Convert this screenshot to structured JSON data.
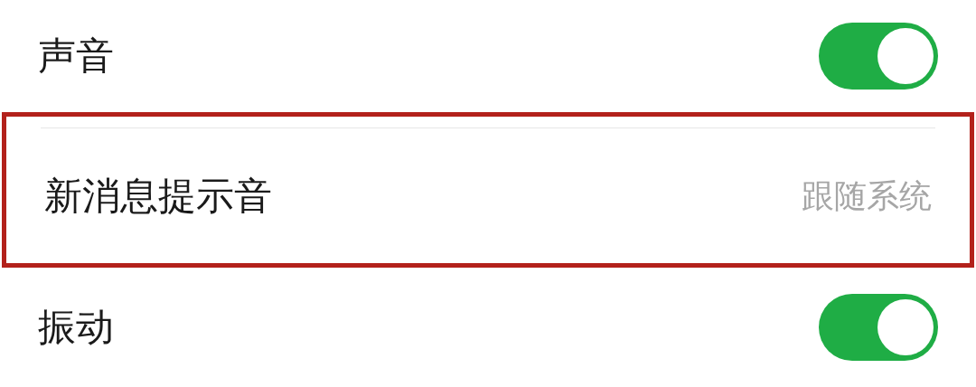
{
  "settings": [
    {
      "kind": "toggle",
      "label": "声音",
      "on": true,
      "highlighted": false
    },
    {
      "kind": "value",
      "label": "新消息提示音",
      "value": "跟随系统",
      "highlighted": true
    },
    {
      "kind": "toggle",
      "label": "振动",
      "on": true,
      "highlighted": false
    }
  ]
}
